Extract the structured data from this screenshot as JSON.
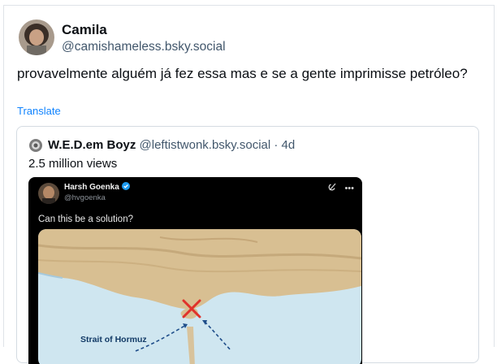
{
  "post": {
    "author_name": "Camila",
    "author_handle": "@camishameless.bsky.social",
    "text": "provavelmente alguém já fez essa mas e se a gente imprimisse petróleo?",
    "translate_label": "Translate"
  },
  "quote": {
    "author_name": "W.E.D.em Boyz",
    "author_handle": "@leftistwonk.bsky.social",
    "separator": "·",
    "time": "4d",
    "views": "2.5 million views"
  },
  "embedded_tweet": {
    "author_name": "Harsh Goenka",
    "author_handle": "@hvgoenka",
    "text": "Can this be a solution?",
    "map_label": "Strait of Hormuz",
    "icons": [
      "verified-badge-icon",
      "grok-icon",
      "more-icon"
    ]
  },
  "colors": {
    "link": "#1083fe",
    "muted": "#42576c",
    "verified": "#1d9bf0",
    "sea": "#cfe6f0",
    "land": "#d8bf92",
    "marker": "#e0322b"
  }
}
